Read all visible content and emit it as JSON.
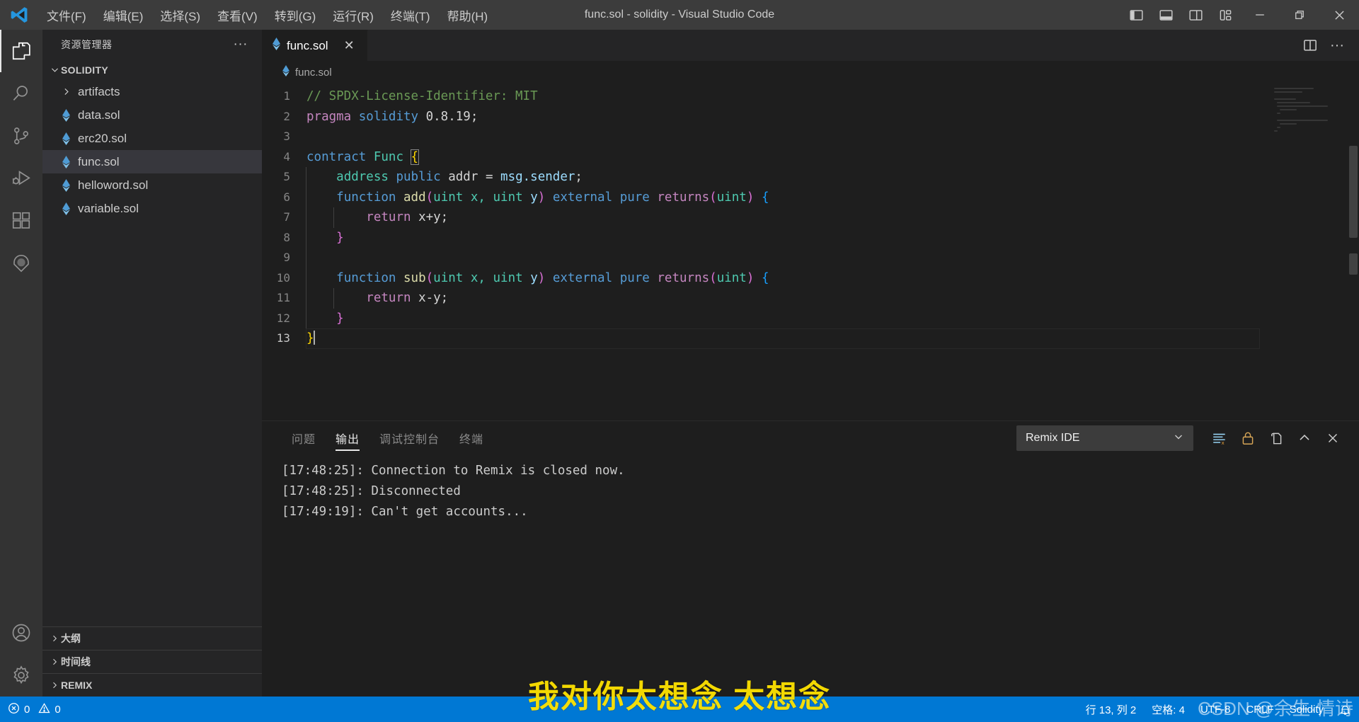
{
  "window": {
    "title": "func.sol - solidity - Visual Studio Code",
    "logo": "vscode-logo"
  },
  "menu": [
    {
      "label": "文件(F)",
      "name": "menu-file"
    },
    {
      "label": "编辑(E)",
      "name": "menu-edit"
    },
    {
      "label": "选择(S)",
      "name": "menu-selection"
    },
    {
      "label": "查看(V)",
      "name": "menu-view"
    },
    {
      "label": "转到(G)",
      "name": "menu-go"
    },
    {
      "label": "运行(R)",
      "name": "menu-run"
    },
    {
      "label": "终端(T)",
      "name": "menu-terminal"
    },
    {
      "label": "帮助(H)",
      "name": "menu-help"
    }
  ],
  "titlebar_actions": [
    {
      "name": "toggle-primary-sidebar-icon"
    },
    {
      "name": "toggle-panel-icon"
    },
    {
      "name": "toggle-secondary-sidebar-icon"
    },
    {
      "name": "customize-layout-icon"
    }
  ],
  "window_controls": [
    {
      "name": "minimize-button",
      "glyph": "—"
    },
    {
      "name": "restore-button",
      "glyph": "❐"
    },
    {
      "name": "close-button",
      "glyph": "✕"
    }
  ],
  "activitybar": [
    {
      "name": "activity-explorer",
      "icon": "files-icon",
      "active": true
    },
    {
      "name": "activity-search",
      "icon": "search-icon",
      "active": false
    },
    {
      "name": "activity-source-control",
      "icon": "source-control-icon",
      "active": false
    },
    {
      "name": "activity-run-debug",
      "icon": "run-and-debug-icon",
      "active": false
    },
    {
      "name": "activity-extensions",
      "icon": "extensions-icon",
      "active": false
    },
    {
      "name": "activity-remix",
      "icon": "remix-icon",
      "active": false
    }
  ],
  "activitybar_bottom": [
    {
      "name": "activity-accounts",
      "icon": "account-icon"
    },
    {
      "name": "activity-settings",
      "icon": "gear-icon"
    }
  ],
  "sidebar": {
    "title": "资源管理器",
    "more_actions": "···",
    "root": {
      "label": "SOLIDITY",
      "expanded": true
    },
    "files": [
      {
        "label": "artifacts",
        "type": "folder",
        "icon": "chevron-right-icon",
        "selected": false
      },
      {
        "label": "data.sol",
        "type": "file",
        "icon": "solidity-file-icon",
        "selected": false
      },
      {
        "label": "erc20.sol",
        "type": "file",
        "icon": "solidity-file-icon",
        "selected": false
      },
      {
        "label": "func.sol",
        "type": "file",
        "icon": "solidity-file-icon",
        "selected": true
      },
      {
        "label": "helloword.sol",
        "type": "file",
        "icon": "solidity-file-icon",
        "selected": false
      },
      {
        "label": "variable.sol",
        "type": "file",
        "icon": "solidity-file-icon",
        "selected": false
      }
    ],
    "collapsed_sections": [
      {
        "label": "大纲",
        "name": "sidebar-section-outline"
      },
      {
        "label": "时间线",
        "name": "sidebar-section-timeline"
      },
      {
        "label": "REMIX",
        "name": "sidebar-section-remix"
      }
    ]
  },
  "editor": {
    "tabs": [
      {
        "label": "func.sol",
        "icon": "solidity-file-icon",
        "active": true,
        "close": "✕"
      }
    ],
    "tab_actions": [
      {
        "name": "split-editor-right-icon",
        "glyph": "▥"
      },
      {
        "name": "editor-more-actions-icon",
        "glyph": "···"
      }
    ],
    "breadcrumb": "func.sol",
    "breadcrumb_icon": "solidity-file-icon",
    "lines": [
      {
        "n": 1,
        "text": "// SPDX-License-Identifier: MIT"
      },
      {
        "n": 2,
        "text": "pragma solidity 0.8.19;"
      },
      {
        "n": 3,
        "text": ""
      },
      {
        "n": 4,
        "text": "contract Func {"
      },
      {
        "n": 5,
        "text": "    address public addr = msg.sender;"
      },
      {
        "n": 6,
        "text": "    function add(uint x, uint y) external pure returns(uint) {"
      },
      {
        "n": 7,
        "text": "        return x+y;"
      },
      {
        "n": 8,
        "text": "    }"
      },
      {
        "n": 9,
        "text": ""
      },
      {
        "n": 10,
        "text": "    function sub(uint x, uint y) external pure returns(uint) {"
      },
      {
        "n": 11,
        "text": "        return x-y;"
      },
      {
        "n": 12,
        "text": "    }"
      },
      {
        "n": 13,
        "text": "}"
      }
    ]
  },
  "panel": {
    "tabs": [
      {
        "label": "问题",
        "name": "panel-tab-problems",
        "active": false
      },
      {
        "label": "输出",
        "name": "panel-tab-output",
        "active": true
      },
      {
        "label": "调试控制台",
        "name": "panel-tab-debug-console",
        "active": false
      },
      {
        "label": "终端",
        "name": "panel-tab-terminal",
        "active": false
      }
    ],
    "channel": "Remix IDE",
    "actions": [
      {
        "name": "clear-output-icon"
      },
      {
        "name": "lock-scroll-icon"
      },
      {
        "name": "open-output-in-editor-icon"
      },
      {
        "name": "maximize-panel-icon"
      },
      {
        "name": "close-panel-icon"
      }
    ],
    "output_lines": [
      "[17:48:25]: Connection to Remix is closed now.",
      "[17:48:25]: Disconnected",
      "[17:49:19]: Can't get accounts..."
    ]
  },
  "statusbar": {
    "left": [
      {
        "name": "status-errors-warnings",
        "errors_icon": "error-circle-icon",
        "errors": "0",
        "warnings_icon": "warning-triangle-icon",
        "warnings": "0"
      }
    ],
    "right": [
      {
        "name": "status-cursor-position",
        "label": "行 13, 列 2"
      },
      {
        "name": "status-indentation",
        "label": "空格: 4"
      },
      {
        "name": "status-encoding",
        "label": "UTF-8"
      },
      {
        "name": "status-eol",
        "label": "CRLF"
      },
      {
        "name": "status-language-mode",
        "label": "Solidity"
      },
      {
        "name": "status-notifications",
        "label": "🔔"
      }
    ]
  },
  "watermarks": {
    "center": "我对你太想念 太想念",
    "corner": "CSDN @余生·情诗"
  },
  "colors": {
    "accent": "#0078d4",
    "titlebar": "#3c3c3c",
    "activitybar": "#333333",
    "sidebar": "#252526",
    "editor": "#1e1e1e",
    "selected_row": "#37373d",
    "comment": "#6A9955",
    "keyword": "#C586C0",
    "keyword2": "#569CD6",
    "type": "#4EC9B0",
    "function": "#DCDCAA",
    "number": "#B5CEA8",
    "variable": "#9CDCFE",
    "watermark": "#ffe300"
  }
}
